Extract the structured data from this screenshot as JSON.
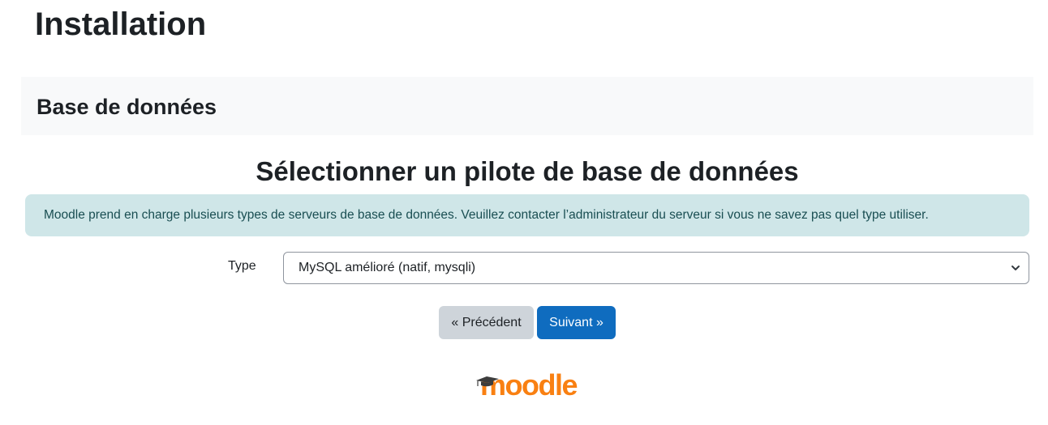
{
  "page": {
    "title": "Installation",
    "stage_title": "Base de données",
    "section_title": "Sélectionner un pilote de base de données",
    "info_text": "Moodle prend en charge plusieurs types de serveurs de base de données. Veuillez contacter l’administrateur du serveur si vous ne savez pas quel type utiliser."
  },
  "form": {
    "type_label": "Type",
    "type_selected": "MySQL amélioré (natif, mysqli)"
  },
  "buttons": {
    "previous_label": "« Précédent",
    "next_label": "Suivant »"
  },
  "logo": {
    "text": "moodle",
    "icon": "graduation-cap-icon"
  },
  "colors": {
    "primary": "#0f6cbf",
    "secondary_button": "#ced4da",
    "info_background": "#cfe6e8",
    "info_text": "#194e52",
    "header_background": "#f8f9fa",
    "logo_orange": "#f98012"
  }
}
